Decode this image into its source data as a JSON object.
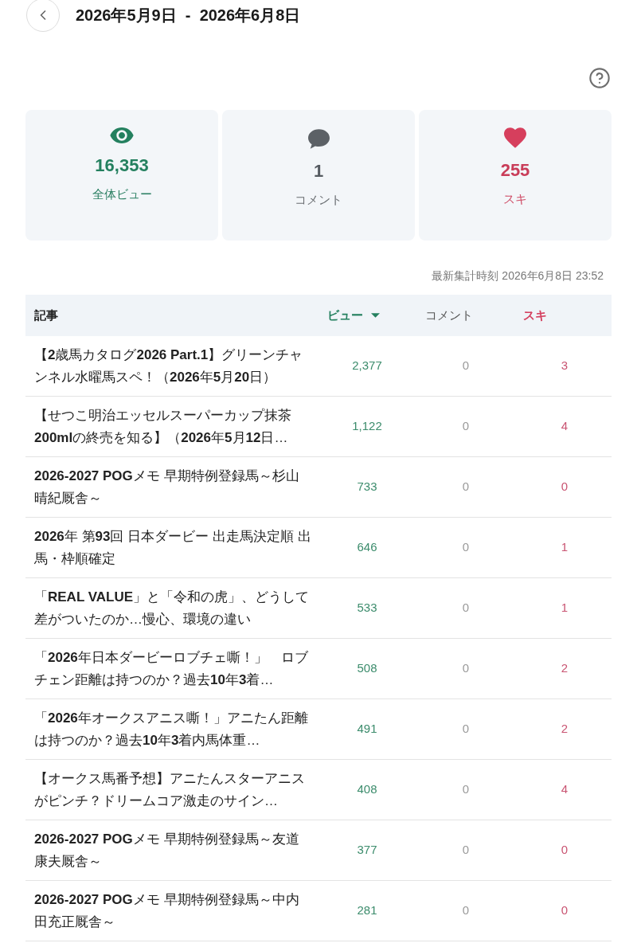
{
  "header": {
    "title": "2026年5月9日  -  2026年6月8日"
  },
  "summary_cards": [
    {
      "kind": "views",
      "value": "16,353",
      "label": "全体ビュー"
    },
    {
      "kind": "comments",
      "value": "1",
      "label": "コメント"
    },
    {
      "kind": "likes",
      "value": "255",
      "label": "スキ"
    }
  ],
  "updated_at": "最新集計時刻 2026年6月8日 23:52",
  "table": {
    "columns": [
      {
        "kind": "title",
        "label": "記事",
        "sorted": false
      },
      {
        "kind": "views",
        "label": "ビュー",
        "sorted": true
      },
      {
        "kind": "comments",
        "label": "コメント",
        "sorted": false
      },
      {
        "kind": "likes",
        "label": "スキ",
        "sorted": false
      }
    ],
    "rows": [
      {
        "title": "【**2**歳馬カタログ**2026 Part.1**】グリーンチャンネル水曜馬スペ！（**2026**年**5**月**20**日）",
        "views": "2,377",
        "comments": "0",
        "likes": "3"
      },
      {
        "title": "【せつこ明治エッセルスーパーカップ抹茶**200ml**の終売を知る】（**2026**年**5**月**12**日…",
        "views": "1,122",
        "comments": "0",
        "likes": "4"
      },
      {
        "title": "**2026-2027 POG**メモ 早期特例登録馬～杉山晴紀厩舎～",
        "views": "733",
        "comments": "0",
        "likes": "0"
      },
      {
        "title": "**2026**年 第**93**回 日本ダービー 出走馬決定順 出馬・枠順確定",
        "views": "646",
        "comments": "0",
        "likes": "1"
      },
      {
        "title": "「**REAL VALUE**」と「令和の虎」、どうして差がついたのか…慢心、環境の違い",
        "views": "533",
        "comments": "0",
        "likes": "1"
      },
      {
        "title": "「**2026**年日本ダービーロブチェ嘶！」　ロブチェン距離は持つのか？過去**10**年**3**着…",
        "views": "508",
        "comments": "0",
        "likes": "2"
      },
      {
        "title": "「**2026**年オークスアニス嘶！」アニたん距離は持つのか？過去**10**年**3**着内馬体重…",
        "views": "491",
        "comments": "0",
        "likes": "2"
      },
      {
        "title": "【オークス馬番予想】アニたんスターアニスがピンチ？ドリームコア激走のサイン…",
        "views": "408",
        "comments": "0",
        "likes": "4"
      },
      {
        "title": "**2026-2027 POG**メモ 早期特例登録馬～友道康夫厩舎～",
        "views": "377",
        "comments": "0",
        "likes": "0"
      },
      {
        "title": "**2026-2027 POG**メモ 早期特例登録馬～中内田充正厩舎～",
        "views": "281",
        "comments": "0",
        "likes": "0"
      }
    ]
  }
}
